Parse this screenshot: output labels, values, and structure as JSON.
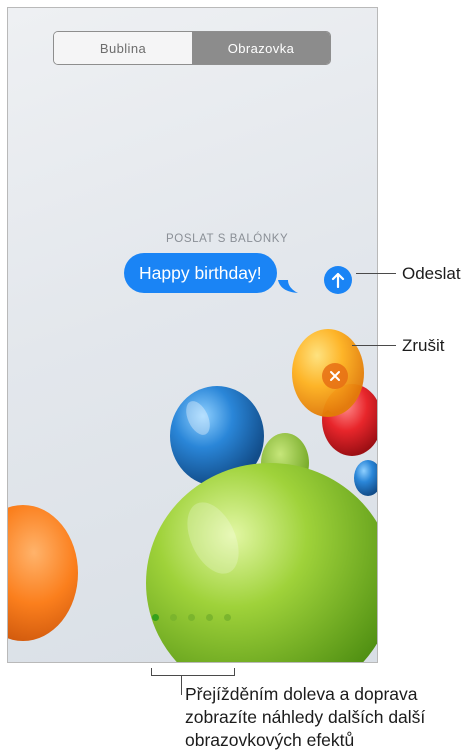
{
  "segmented_control": {
    "tabs": [
      {
        "label": "Bublina",
        "selected": false
      },
      {
        "label": "Obrazovka",
        "selected": true
      }
    ]
  },
  "message": {
    "effect_label": "POSLAT S BALÓNKY",
    "text": "Happy birthday!"
  },
  "page_indicator": {
    "count": 5,
    "active_index": 0
  },
  "callouts": {
    "send": "Odeslat",
    "cancel": "Zrušit",
    "swipe_line1": "Přejížděním doleva a doprava",
    "swipe_line2": "zobrazíte náhledy dalších další",
    "swipe_line3": "obrazovkových efektů"
  },
  "colors": {
    "accent_blue": "#1a84f5",
    "dot_green": "#7bb52d"
  }
}
